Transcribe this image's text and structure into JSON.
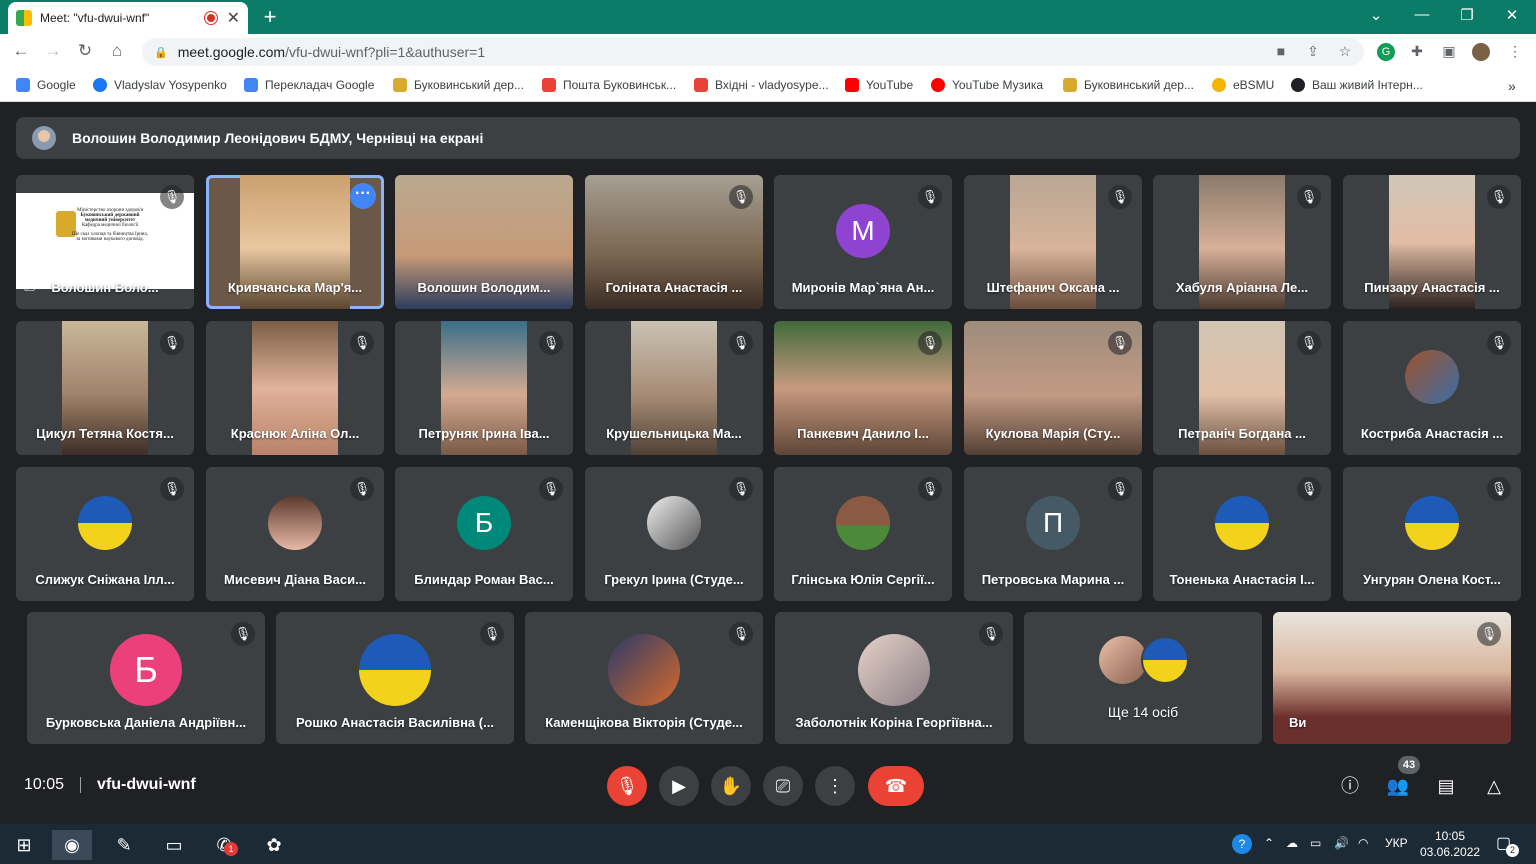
{
  "browser": {
    "tab_title": "Meet: \"vfu-dwui-wnf\"",
    "url_host": "meet.google.com",
    "url_path": "/vfu-dwui-wnf?pli=1&authuser=1",
    "bookmarks": [
      {
        "label": "Google",
        "color": "#4285f4"
      },
      {
        "label": "Vladyslav Yosypenko",
        "color": "#1877f2"
      },
      {
        "label": "Перекладач Google",
        "color": "#4285f4"
      },
      {
        "label": "Буковинський дер...",
        "color": "#d9a92b"
      },
      {
        "label": "Пошта Буковинськ...",
        "color": "#ea4335"
      },
      {
        "label": "Вхідні - vladyosype...",
        "color": "#ea4335"
      },
      {
        "label": "YouTube",
        "color": "#ff0000"
      },
      {
        "label": "YouTube Музика",
        "color": "#ff0000"
      },
      {
        "label": "Буковинський дер...",
        "color": "#d9a92b"
      },
      {
        "label": "eBSMU",
        "color": "#f4b400"
      },
      {
        "label": "Ваш живий Інтерн...",
        "color": "#202124"
      }
    ]
  },
  "meet": {
    "presenter_banner": "Волошин Володимир Леонідович БДМУ, Чернівці на екрані",
    "tiles_row1": [
      {
        "name": "Волошин Воло..."
      },
      {
        "name": "Кривчанська Мар'я..."
      },
      {
        "name": "Волошин Володим..."
      },
      {
        "name": "Голіната Анастасія ..."
      },
      {
        "name": "Миронів Мар`яна Ан...",
        "initial": "М",
        "avatar_color": "#8e44d0"
      },
      {
        "name": "Штефанич Оксана ..."
      },
      {
        "name": "Хабуля Аріанна Ле..."
      },
      {
        "name": "Пинзару Анастасія ..."
      }
    ],
    "tiles_row2": [
      {
        "name": "Цикул Тетяна Костя..."
      },
      {
        "name": "Краснюк Аліна Ол..."
      },
      {
        "name": "Петруняк Ірина Іва..."
      },
      {
        "name": "Крушельницька Ма..."
      },
      {
        "name": "Панкевич Данило І..."
      },
      {
        "name": "Куклова Марія (Сту..."
      },
      {
        "name": "Петраніч Богдана ..."
      },
      {
        "name": "Костриба Анастасія ..."
      }
    ],
    "tiles_row3": [
      {
        "name": "Слижук Сніжана Ілл..."
      },
      {
        "name": "Мисевич Діана Васи..."
      },
      {
        "name": "Блиндар Роман Вас...",
        "initial": "Б",
        "avatar_color": "#00897b"
      },
      {
        "name": "Грекул Ірина (Студе..."
      },
      {
        "name": "Глінська Юлія Сергії..."
      },
      {
        "name": "Петровська Марина ...",
        "initial": "П",
        "avatar_color": "#455a64"
      },
      {
        "name": "Тоненька Анастасія І..."
      },
      {
        "name": "Унгурян Олена Кост..."
      }
    ],
    "tiles_row4": [
      {
        "name": "Бурковська Даніела Андріївн...",
        "initial": "Б",
        "avatar_color": "#ec407a"
      },
      {
        "name": "Рошко Анастасія Василівна (..."
      },
      {
        "name": "Каменщікова Вікторія (Студе..."
      },
      {
        "name": "Заболотнік Коріна Георгіївна..."
      },
      {
        "name": "Ще 14 осіб"
      },
      {
        "name": "Ви"
      }
    ],
    "slide_text": [
      "Міністерство охорони здоров'я",
      "Буковинський державний",
      "медичний університет",
      "Кафедра медичної біології",
      "Ще сказ хлопця та бівництва Ірина,",
      "за мотивами наукового доповід."
    ],
    "time": "10:05",
    "meeting_code": "vfu-dwui-wnf",
    "participants_count": "43"
  },
  "taskbar": {
    "lang": "УКР",
    "time": "10:05",
    "date": "03.06.2022",
    "notifications": "2",
    "viber_badge": "1"
  }
}
